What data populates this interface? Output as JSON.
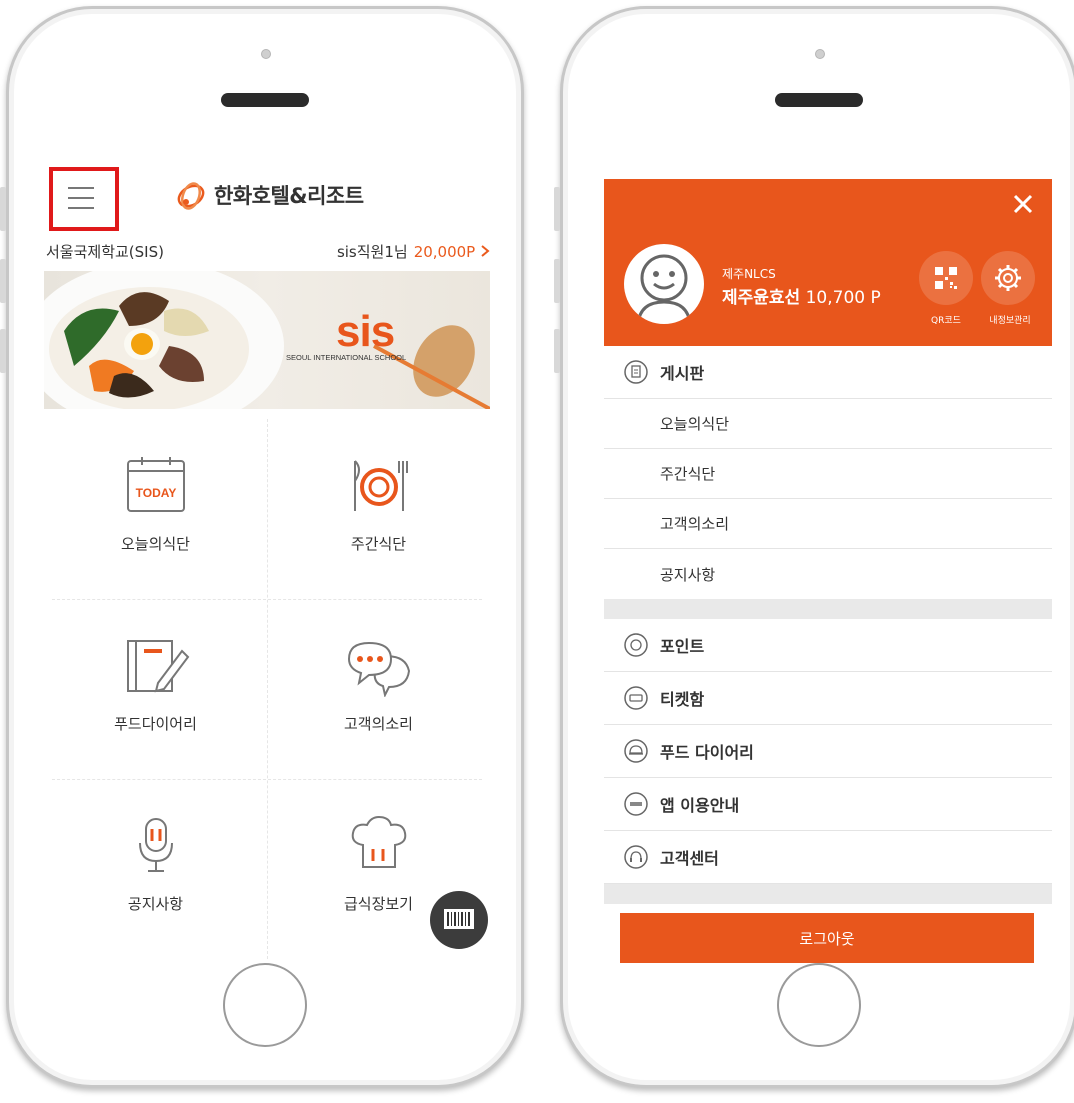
{
  "left_phone": {
    "brand": "한화호텔&리조트",
    "school": "서울국제학교(SIS)",
    "user": "sis직원1님",
    "points": "20,000P",
    "banner_logo": "sis",
    "banner_sub": "SEOUL INTERNATIONAL SCHOOL",
    "grid": [
      {
        "label": "오늘의식단",
        "icon": "calendar-today-icon",
        "badge": "TODAY"
      },
      {
        "label": "주간식단",
        "icon": "plate-utensils-icon"
      },
      {
        "label": "푸드다이어리",
        "icon": "diary-pencil-icon"
      },
      {
        "label": "고객의소리",
        "icon": "chat-bubble-icon"
      },
      {
        "label": "공지사항",
        "icon": "microphone-icon"
      },
      {
        "label": "급식장보기",
        "icon": "chef-hat-icon"
      }
    ],
    "barcode_icon": "barcode-icon"
  },
  "right_phone": {
    "profile": {
      "site": "제주NLCS",
      "name": "제주윤효선",
      "points": "10,700 P",
      "qr_label": "QR코드",
      "settings_label": "내정보관리"
    },
    "board": {
      "title": "게시판",
      "items": [
        "오늘의식단",
        "주간식단",
        "고객의소리",
        "공지사항"
      ]
    },
    "menu": [
      {
        "label": "포인트",
        "icon": "coin-icon"
      },
      {
        "label": "티켓함",
        "icon": "ticket-icon"
      },
      {
        "label": "푸드 다이어리",
        "icon": "food-dome-icon"
      },
      {
        "label": "앱 이용안내",
        "icon": "app-guide-icon"
      },
      {
        "label": "고객센터",
        "icon": "headset-icon"
      }
    ],
    "logout": "로그아웃"
  },
  "colors": {
    "accent": "#e8561c",
    "highlight": "#e0191a"
  }
}
